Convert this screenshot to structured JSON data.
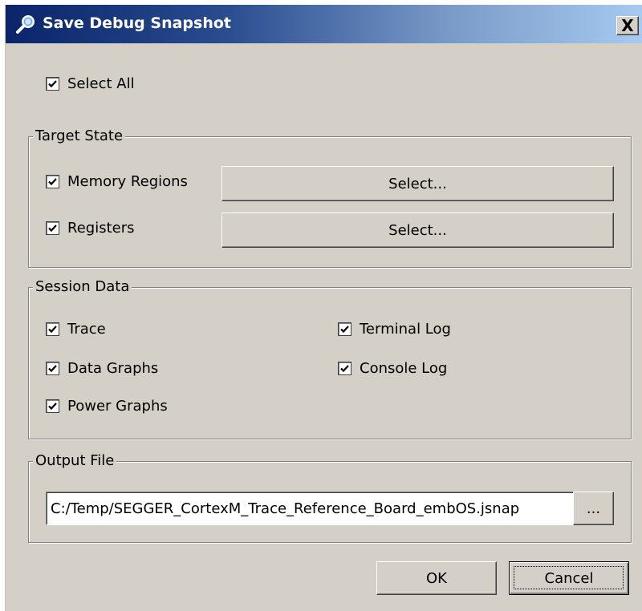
{
  "window": {
    "title": "Save Debug Snapshot",
    "close_label": "X"
  },
  "select_all": {
    "label": "Select All",
    "checked": true
  },
  "target_state": {
    "title": "Target State",
    "items": [
      {
        "label": "Memory Regions",
        "checked": true,
        "button": "Select..."
      },
      {
        "label": "Registers",
        "checked": true,
        "button": "Select..."
      }
    ]
  },
  "session_data": {
    "title": "Session Data",
    "items": [
      {
        "label": "Trace",
        "checked": true
      },
      {
        "label": "Terminal Log",
        "checked": true
      },
      {
        "label": "Data Graphs",
        "checked": true
      },
      {
        "label": "Console Log",
        "checked": true
      },
      {
        "label": "Power Graphs",
        "checked": true
      }
    ]
  },
  "output_file": {
    "title": "Output File",
    "path": "C:/Temp/SEGGER_CortexM_Trace_Reference_Board_embOS.jsnap",
    "browse_label": "..."
  },
  "buttons": {
    "ok": "OK",
    "cancel": "Cancel"
  },
  "colors": {
    "dialog_bg": "#d4d0c8",
    "title_start": "#0a246a",
    "title_end": "#a6caf0"
  }
}
